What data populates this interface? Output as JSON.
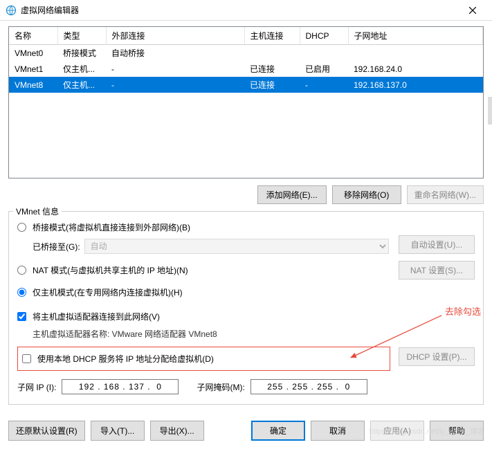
{
  "window": {
    "title": "虚拟网络编辑器"
  },
  "table": {
    "headers": [
      "名称",
      "类型",
      "外部连接",
      "主机连接",
      "DHCP",
      "子网地址"
    ],
    "rows": [
      {
        "name": "VMnet0",
        "type": "桥接模式",
        "ext": "自动桥接",
        "host": "",
        "dhcp": "",
        "subnet": "",
        "selected": false
      },
      {
        "name": "VMnet1",
        "type": "仅主机...",
        "ext": "-",
        "host": "已连接",
        "dhcp": "已启用",
        "subnet": "192.168.24.0",
        "selected": false
      },
      {
        "name": "VMnet8",
        "type": "仅主机...",
        "ext": "-",
        "host": "已连接",
        "dhcp": "-",
        "subnet": "192.168.137.0",
        "selected": true
      }
    ]
  },
  "netButtons": {
    "add": "添加网络(E)...",
    "remove": "移除网络(O)",
    "rename": "重命名网络(W)..."
  },
  "vmnetInfo": {
    "title": "VMnet 信息",
    "bridged": "桥接模式(将虚拟机直接连接到外部网络)(B)",
    "bridgedTo": "已桥接至(G):",
    "bridgedAuto": "自动",
    "autoSettings": "自动设置(U)...",
    "nat": "NAT 模式(与虚拟机共享主机的 IP 地址)(N)",
    "natSettings": "NAT 设置(S)...",
    "hostonly": "仅主机模式(在专用网络内连接虚拟机)(H)",
    "connectHost": "将主机虚拟适配器连接到此网络(V)",
    "adapterLabel": "主机虚拟适配器名称: VMware 网络适配器 VMnet8",
    "dhcp": "使用本地 DHCP 服务将 IP 地址分配给虚拟机(D)",
    "dhcpSettings": "DHCP 设置(P)...",
    "subnetIpLabel": "子网 IP (I):",
    "subnetIp": "192 . 168 . 137 .  0",
    "subnetMaskLabel": "子网掩码(M):",
    "subnetMask": "255 . 255 . 255 .  0"
  },
  "annotation": {
    "label": "去除勾选"
  },
  "bottom": {
    "restore": "还原默认设置(R)",
    "import": "导入(T)...",
    "export": "导出(X)...",
    "ok": "确定",
    "cancel": "取消",
    "apply": "应用(A)",
    "help": "帮助"
  },
  "watermark": "https://blog.csdn.net/ly_6118_博客"
}
